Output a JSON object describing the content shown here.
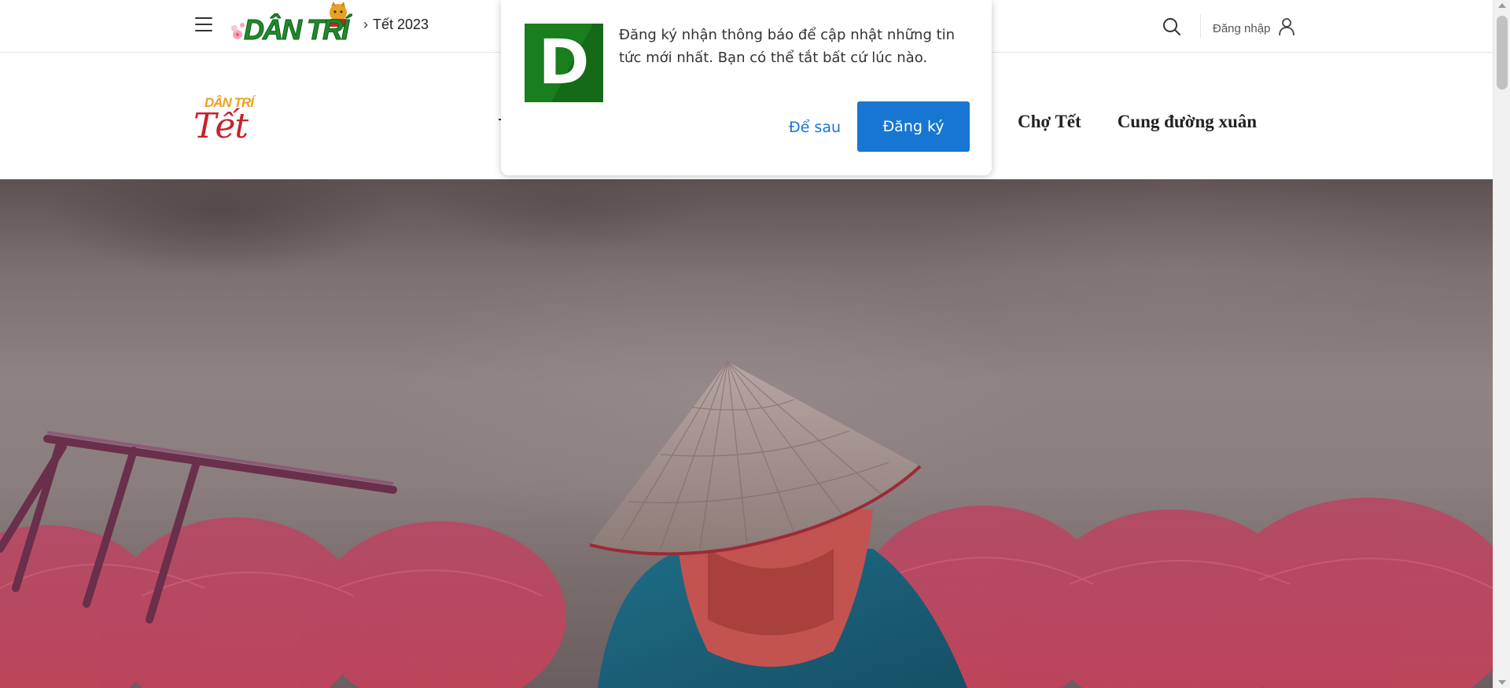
{
  "header": {
    "brand_text": "DÂN TRÍ",
    "breadcrumb_separator": "›",
    "breadcrumb_current": "Tết 2023",
    "login_label": "Đăng nhập",
    "icons": [
      "hamburger-icon",
      "search-icon",
      "user-icon"
    ]
  },
  "subnav": {
    "logo_small": "DÂN TRÍ",
    "logo_big": "Tết",
    "items": [
      {
        "label": "Chợ Tết"
      },
      {
        "label": "Cung đường xuân"
      }
    ]
  },
  "prompt": {
    "logo_letter": "D",
    "message": "Đăng ký nhận thông báo để cập nhật những tin tức mới nhất. Bạn có thể tắt bất cứ lúc nào.",
    "later_label": "Để sau",
    "subscribe_label": "Đăng ký",
    "colors": {
      "logo_bg": "#1a7d1e",
      "button_bg": "#1676d2",
      "link": "#1a73d9"
    }
  },
  "colors": {
    "brand_green": "#1f8a2a",
    "tet_red": "#c7222a",
    "tet_gold": "#e8a126"
  }
}
